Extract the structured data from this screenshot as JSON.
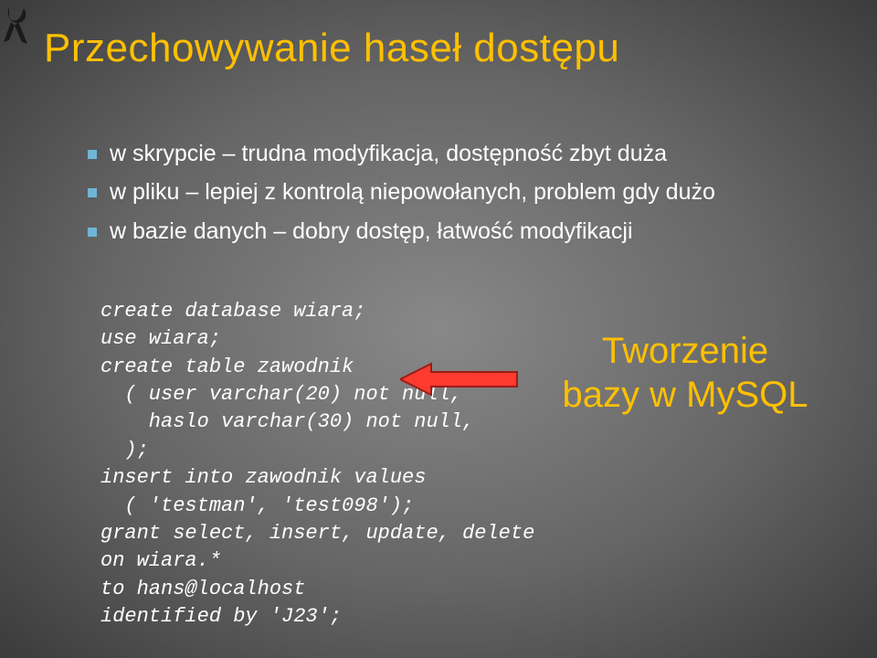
{
  "title": "Przechowywanie haseł dostępu",
  "bullets": {
    "b0": "w skrypcie – trudna modyfikacja, dostępność zbyt duża",
    "b1": "w pliku – lepiej z kontrolą niepowołanych, problem gdy dużo",
    "b2": "w bazie danych – dobry dostęp, łatwość modyfikacji"
  },
  "callout": {
    "line1": "Tworzenie",
    "line2": "bazy w MySQL"
  },
  "code": {
    "l0": "create database wiara;",
    "l1": "use wiara;",
    "l2": "create table zawodnik",
    "l3": "  ( user varchar(20) not null,",
    "l4": "    haslo varchar(30) not null,",
    "l5": "  );",
    "l6": "insert into zawodnik values",
    "l7": "  ( 'testman', 'test098');",
    "l8": "grant select, insert, update, delete",
    "l9": "on wiara.*",
    "l10": "to hans@localhost",
    "l11": "identified by 'J23';"
  },
  "colors": {
    "accent": "#ffc000",
    "bullet_marker": "#6fb5d6",
    "arrow_fill": "#ff3a2f",
    "arrow_stroke": "#9d1c15"
  }
}
